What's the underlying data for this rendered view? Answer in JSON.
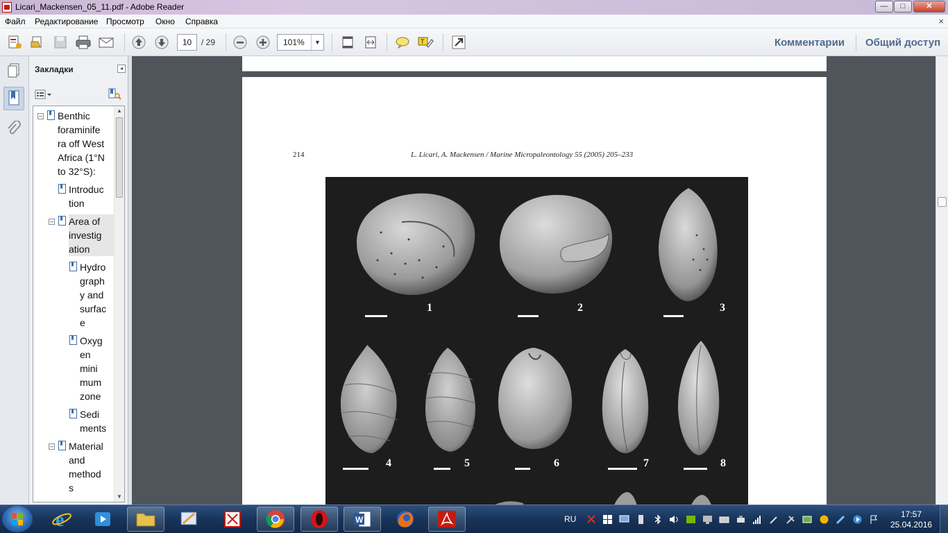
{
  "window": {
    "title": "Licari_Mackensen_05_11.pdf - Adobe Reader",
    "controls": {
      "minimize": "—",
      "maximize": "□",
      "close": "✕"
    }
  },
  "menu": {
    "items": [
      "Файл",
      "Редактирование",
      "Просмотр",
      "Окно",
      "Справка"
    ],
    "close": "×"
  },
  "toolbar": {
    "page_current": "10",
    "page_total": "/ 29",
    "zoom": "101%",
    "comments_label": "Комментарии",
    "share_label": "Общий доступ"
  },
  "bookmarks": {
    "title": "Закладки",
    "collapse": "◂",
    "items": [
      {
        "text": "Benthic foraminifera off West Africa (1°N to 32°S):",
        "lines": [
          "Benthic",
          "foraminife",
          "ra off West",
          "Africa (1°N",
          "to 32°S):"
        ],
        "expander": "–"
      },
      {
        "text": "Introduction",
        "lines": [
          "Introduc",
          "tion"
        ]
      },
      {
        "text": "Area of investigation",
        "lines": [
          "Area of",
          "investig",
          "ation"
        ],
        "expander": "–",
        "selected": true
      },
      {
        "text": "Hydrography and surface",
        "lines": [
          "Hydro",
          "graph",
          "y and",
          "surfac",
          "e"
        ]
      },
      {
        "text": "Oxygen minimum zone",
        "lines": [
          "Oxyg",
          "en",
          "mini",
          "mum",
          "zone"
        ]
      },
      {
        "text": "Sediments",
        "lines": [
          "Sedi",
          "ments"
        ]
      },
      {
        "text": "Material and methods",
        "lines": [
          "Material",
          "and",
          "method",
          "s"
        ],
        "expander": "–"
      }
    ]
  },
  "document": {
    "page_number": "214",
    "running_head": "L. Licari, A. Mackensen / Marine Micropaleontology 55 (2005) 205–233",
    "figure_labels": [
      "1",
      "2",
      "3",
      "4",
      "5",
      "6",
      "7",
      "8"
    ]
  },
  "taskbar": {
    "apps": [
      "internet-explorer",
      "media-player",
      "file-explorer",
      "paint",
      "pdf-tool",
      "chrome",
      "opera",
      "word",
      "firefox",
      "adobe-reader"
    ],
    "language": "RU",
    "time": "17:57",
    "date": "25.04.2016"
  }
}
